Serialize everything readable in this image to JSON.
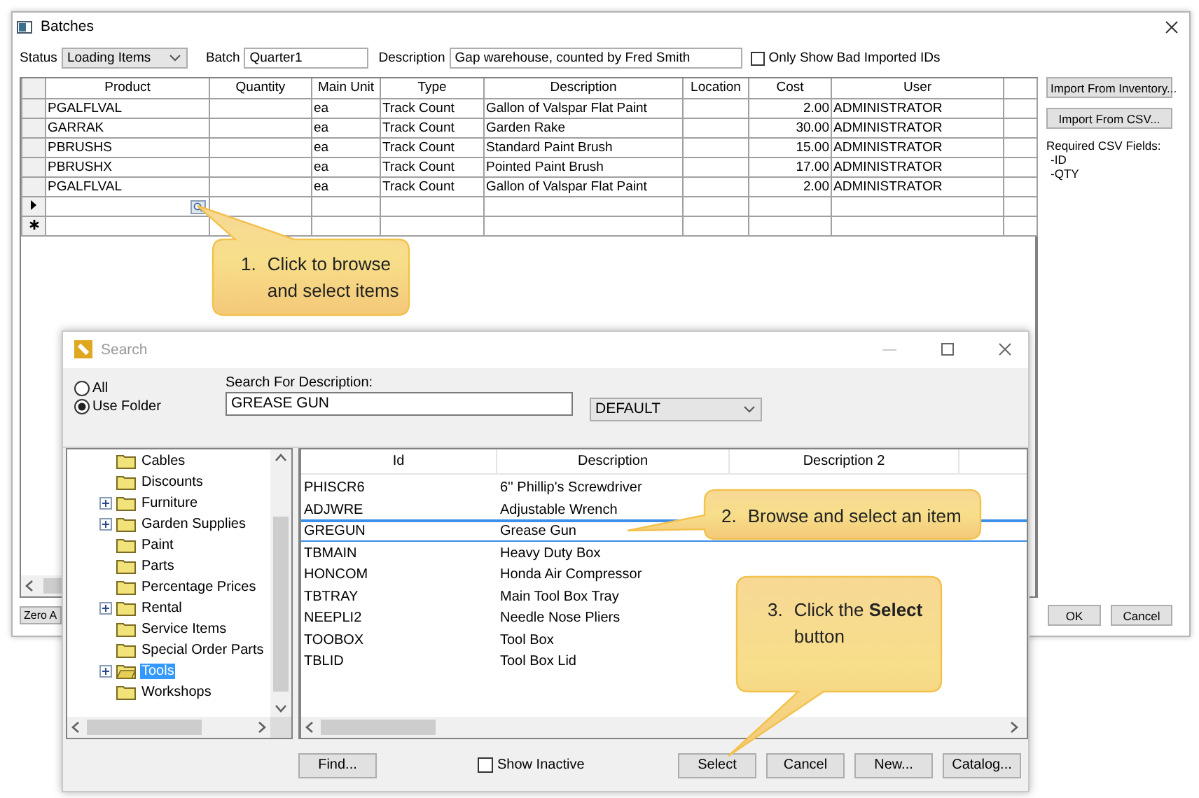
{
  "batches_window": {
    "title": "Batches",
    "toolbar": {
      "status_label": "Status",
      "status_value": "Loading Items",
      "batch_label": "Batch",
      "batch_value": "Quarter1",
      "description_label": "Description",
      "description_value": "Gap warehouse, counted by Fred Smith",
      "bad_ids": {
        "label": "Only Show Bad Imported IDs",
        "checked": false
      }
    },
    "grid": {
      "columns": [
        {
          "label": "Product",
          "kind": "text"
        },
        {
          "label": "Quantity"
        },
        {
          "label": "Main Unit",
          "kind": "text"
        },
        {
          "label": "Type",
          "kind": "text"
        },
        {
          "label": "Description",
          "kind": "text"
        },
        {
          "label": "Location"
        },
        {
          "label": "Cost",
          "kind": "number"
        },
        {
          "label": "User",
          "kind": "text"
        }
      ],
      "rows": [
        {
          "kind": "data",
          "cells": [
            "PGALFLVAL",
            null,
            "ea",
            "Track Count",
            "Gallon of Valspar Flat Paint",
            null,
            "2.00",
            "ADMINISTRATOR"
          ]
        },
        {
          "kind": "data",
          "cells": [
            "GARRAK",
            null,
            "ea",
            "Track Count",
            "Garden Rake",
            null,
            "30.00",
            "ADMINISTRATOR"
          ]
        },
        {
          "kind": "data",
          "cells": [
            "PBRUSHS",
            null,
            "ea",
            "Track Count",
            "Standard Paint Brush",
            null,
            "15.00",
            "ADMINISTRATOR"
          ]
        },
        {
          "kind": "data",
          "cells": [
            "PBRUSHX",
            null,
            "ea",
            "Track Count",
            "Pointed Paint Brush",
            null,
            "17.00",
            "ADMINISTRATOR"
          ]
        },
        {
          "kind": "data",
          "cells": [
            "PGALFLVAL",
            null,
            "ea",
            "Track Count",
            "Gallon of Valspar Flat Paint",
            null,
            "2.00",
            "ADMINISTRATOR"
          ]
        },
        {
          "kind": "current"
        },
        {
          "kind": "new"
        }
      ]
    },
    "side_buttons": [
      "Import From Inventory...",
      "Import From CSV..."
    ],
    "csv_note": [
      "Required CSV Fields:",
      "-ID",
      "-QTY"
    ],
    "zero_button": "Zero A",
    "buttons": [
      "OK",
      "Cancel"
    ]
  },
  "search_dialog": {
    "title": "Search",
    "scope": [
      {
        "label": "All",
        "selected": false
      },
      {
        "label": "Use Folder",
        "selected": true
      }
    ],
    "search_label": "Search For Description:",
    "search_value": "GREASE GUN",
    "filter_value": "DEFAULT",
    "folders": [
      {
        "label": "Cables",
        "expander": false,
        "selected": false
      },
      {
        "label": "Discounts",
        "expander": false,
        "selected": false
      },
      {
        "label": "Furniture",
        "expander": true,
        "selected": false
      },
      {
        "label": "Garden Supplies",
        "expander": true,
        "selected": false
      },
      {
        "label": "Paint",
        "expander": false,
        "selected": false
      },
      {
        "label": "Parts",
        "expander": false,
        "selected": false
      },
      {
        "label": "Percentage Prices",
        "expander": false,
        "selected": false
      },
      {
        "label": "Rental",
        "expander": true,
        "selected": false
      },
      {
        "label": "Service Items",
        "expander": false,
        "selected": false
      },
      {
        "label": "Special Order Parts",
        "expander": false,
        "selected": false
      },
      {
        "label": "Tools",
        "expander": true,
        "selected": true
      },
      {
        "label": "Workshops",
        "expander": false,
        "selected": false
      }
    ],
    "columns": [
      "Id",
      "Description",
      "Description 2"
    ],
    "items": [
      {
        "cells": [
          "PHISCR6",
          "6'' Phillip's Screwdriver"
        ],
        "selected": false
      },
      {
        "cells": [
          "ADJWRE",
          "Adjustable Wrench"
        ],
        "selected": false
      },
      {
        "cells": [
          "GREGUN",
          "Grease Gun"
        ],
        "selected": true
      },
      {
        "cells": [
          "TBMAIN",
          "Heavy Duty Box"
        ],
        "selected": false
      },
      {
        "cells": [
          "HONCOM",
          "Honda Air Compressor"
        ],
        "selected": false
      },
      {
        "cells": [
          "TBTRAY",
          "Main Tool Box Tray"
        ],
        "selected": false
      },
      {
        "cells": [
          "NEEPLI2",
          "Needle Nose Pliers"
        ],
        "selected": false
      },
      {
        "cells": [
          "TOOBOX",
          "Tool Box"
        ],
        "selected": false
      },
      {
        "cells": [
          "TBLID",
          "Tool Box Lid"
        ],
        "selected": false
      }
    ],
    "find_button": "Find...",
    "show_inactive": {
      "label": "Show Inactive",
      "checked": false
    },
    "buttons": [
      "Select",
      "Cancel",
      "New...",
      "Catalog..."
    ]
  },
  "callouts": [
    {
      "number": "1.",
      "text": "Click to browse and select items"
    },
    {
      "number": "2.",
      "text": "Browse and select an item"
    },
    {
      "number": "3.",
      "text": "Click the **Select** button"
    }
  ]
}
